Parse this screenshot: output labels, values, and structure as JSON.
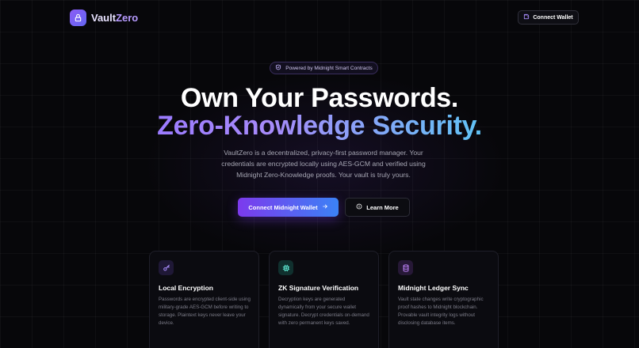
{
  "brand": {
    "name_part1": "Vault",
    "name_part2": "Zero",
    "logo_icon": "lock-icon"
  },
  "header": {
    "connect_label": "Connect Wallet",
    "connect_icon": "wallet-icon"
  },
  "badge": {
    "label": "Powered by Midnight Smart Contracts",
    "icon": "shield-icon"
  },
  "hero": {
    "title_line1": "Own Your Passwords.",
    "title_line2": "Zero-Knowledge Security.",
    "description": "VaultZero is a decentralized, privacy-first password manager. Your credentials are encrypted locally using AES-GCM and verified using Midnight Zero-Knowledge proofs. Your vault is truly yours.",
    "primary_cta": "Connect Midnight Wallet",
    "primary_cta_icon": "arrow-right-icon",
    "secondary_cta": "Learn More",
    "secondary_cta_icon": "info-icon"
  },
  "features": [
    {
      "title": "Local Encryption",
      "body": "Passwords are encrypted client-side using military-grade AES-GCM before writing to storage. Plaintext keys never leave your device.",
      "icon": "key-icon",
      "color": "#a78bfa"
    },
    {
      "title": "ZK Signature Verification",
      "body": "Decryption keys are generated dynamically from your secure wallet signature. Decrypt credentials on-demand with zero permanent keys saved.",
      "icon": "chip-icon",
      "color": "#5eead4"
    },
    {
      "title": "Midnight Ledger Sync",
      "body": "Vault state changes write cryptographic proof hashes to Midnight blockchain. Provable vault integrity logs without disclosing database items.",
      "icon": "database-icon",
      "color": "#c084fc"
    }
  ],
  "colors": {
    "accent": "#7c3aed",
    "accent2": "#3b82f6",
    "background": "#07070a"
  }
}
